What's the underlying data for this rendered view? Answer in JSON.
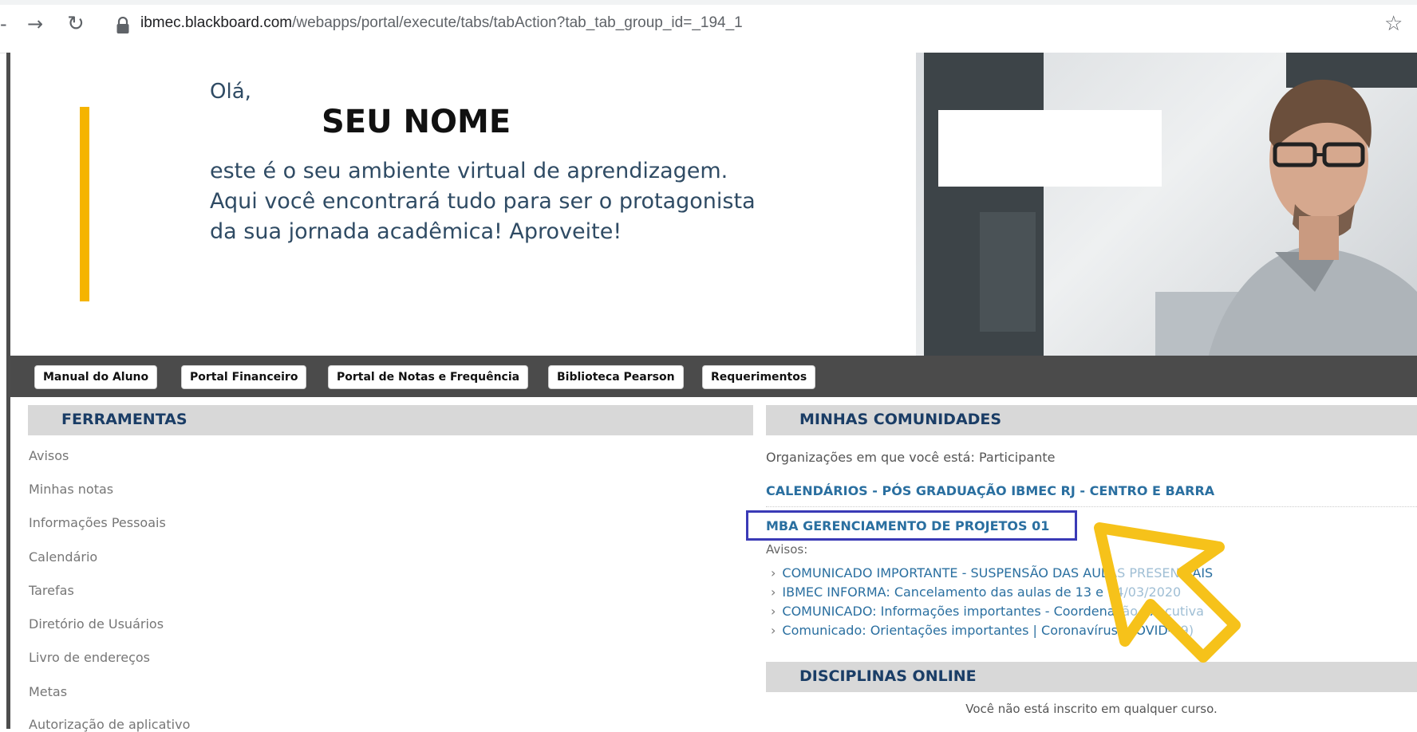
{
  "browser": {
    "url_host": "ibmec.blackboard.com",
    "url_path": "/webapps/portal/execute/tabs/tabAction?tab_tab_group_id=_194_1"
  },
  "banner": {
    "greeting": "Olá,",
    "name": "SEU NOME",
    "intro_lines": [
      "este é o seu ambiente virtual de aprendizagem.",
      "Aqui você encontrará tudo para ser o protagonista",
      "da sua jornada acadêmica! Aproveite!"
    ]
  },
  "quick_links": [
    "Manual do Aluno",
    "Portal Financeiro",
    "Portal de Notas e Frequência",
    "Biblioteca Pearson",
    "Requerimentos"
  ],
  "tools": {
    "title": "FERRAMENTAS",
    "items": [
      "Avisos",
      "Minhas notas",
      "Informações Pessoais",
      "Calendário",
      "Tarefas",
      "Diretório de Usuários",
      "Livro de endereços",
      "Metas",
      "Autorização de aplicativo"
    ]
  },
  "communities": {
    "title": "MINHAS COMUNIDADES",
    "org_line": "Organizações em que você está: Participante",
    "orgs": [
      "CALENDÁRIOS - PÓS GRADUAÇÃO IBMEC RJ - CENTRO E BARRA",
      "MBA GERENCIAMENTO DE PROJETOS 01"
    ],
    "notices_label": "Avisos:",
    "notices": [
      "COMUNICADO IMPORTANTE - SUSPENSÃO DAS AULAS PRESENCIAIS",
      "IBMEC INFORMA: Cancelamento das aulas de 13 e 14/03/2020",
      "COMUNICADO: Informações importantes - Coordenação Executiva",
      "Comunicado: Orientações importantes | Coronavírus (COVID-19)"
    ]
  },
  "online_courses": {
    "title": "DISCIPLINAS ONLINE",
    "empty_message": "Você não está inscrito em qualquer curso."
  },
  "colors": {
    "accent_yellow": "#f5b400",
    "header_navy": "#1a3d66",
    "link_blue": "#2a6fa0",
    "highlight_box": "#3a3ab6",
    "cursor_yellow": "#f6c21a"
  },
  "icons": [
    "back-icon",
    "forward-icon",
    "reload-icon",
    "lock-icon",
    "star-icon",
    "chevron-right-icon",
    "pointer-cursor-icon"
  ]
}
